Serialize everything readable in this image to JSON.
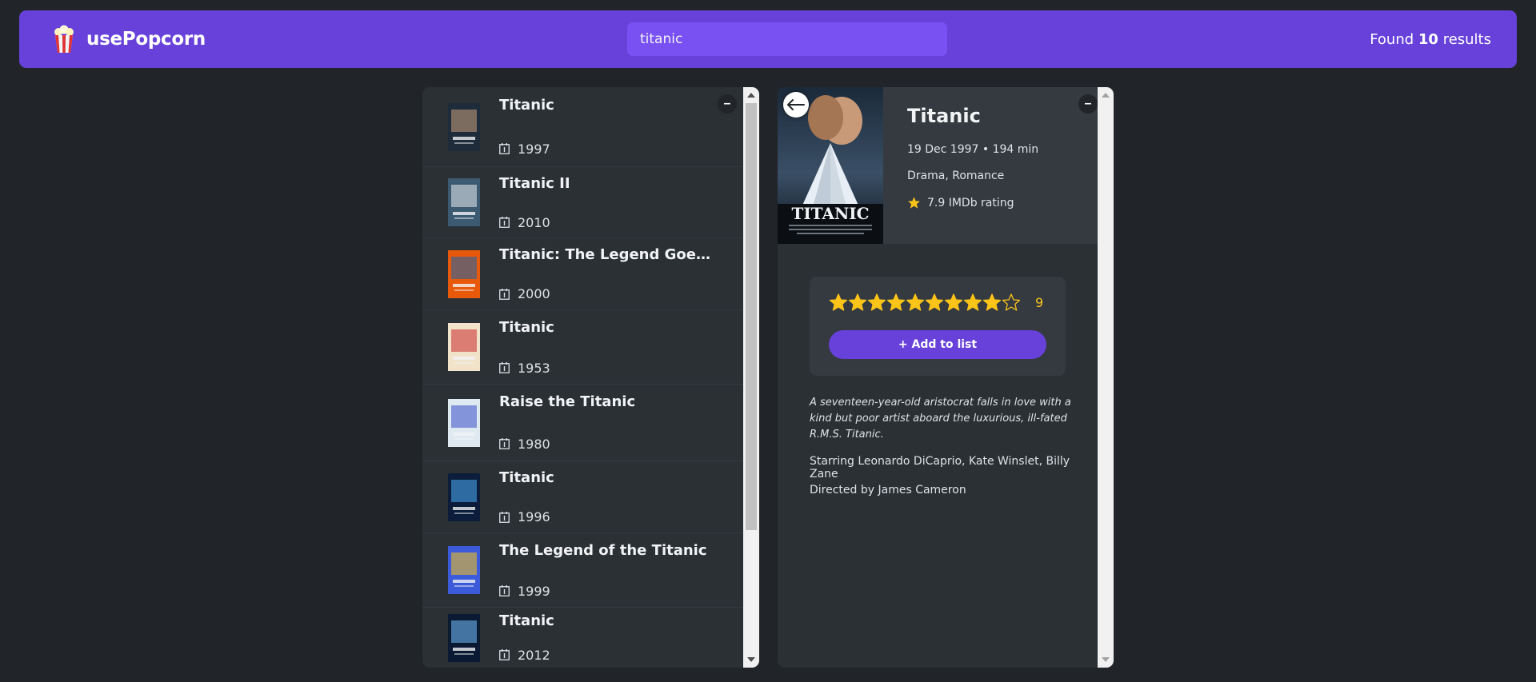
{
  "nav": {
    "logo_text": "usePopcorn",
    "search_value": "titanic",
    "results_prefix": "Found ",
    "results_count": "10",
    "results_suffix": " results"
  },
  "list_box": {
    "toggle_label": "–",
    "movies": [
      {
        "title": "Titanic",
        "year": "1997"
      },
      {
        "title": "Titanic II",
        "year": "2010"
      },
      {
        "title": "Titanic: The Legend Goes On...",
        "year": "2000"
      },
      {
        "title": "Titanic",
        "year": "1953"
      },
      {
        "title": "Raise the Titanic",
        "year": "1980"
      },
      {
        "title": "Titanic",
        "year": "1996"
      },
      {
        "title": "The Legend of the Titanic",
        "year": "1999"
      },
      {
        "title": "Titanic",
        "year": "2012"
      }
    ]
  },
  "details": {
    "toggle_label": "–",
    "back_label": "←",
    "title": "Titanic",
    "released_runtime": "19 Dec 1997 • 194 min",
    "genre": "Drama, Romance",
    "imdb_rating": "7.9 IMDb rating",
    "poster_text": "TITANIC",
    "user_rating": 9,
    "max_rating": 10,
    "rating_display": "9",
    "add_button": "+ Add to list",
    "plot": "A seventeen-year-old aristocrat falls in love with a kind but poor artist aboard the luxurious, ill-fated R.M.S. Titanic.",
    "starring": "Starring Leonardo DiCaprio, Kate Winslet, Billy Zane",
    "director": "Directed by James Cameron"
  },
  "colors": {
    "background": "#212529",
    "nav": "#6741d9",
    "search": "#7950f2",
    "panel": "#2b3035",
    "panel_light": "#343a40",
    "star": "#fcc419"
  }
}
